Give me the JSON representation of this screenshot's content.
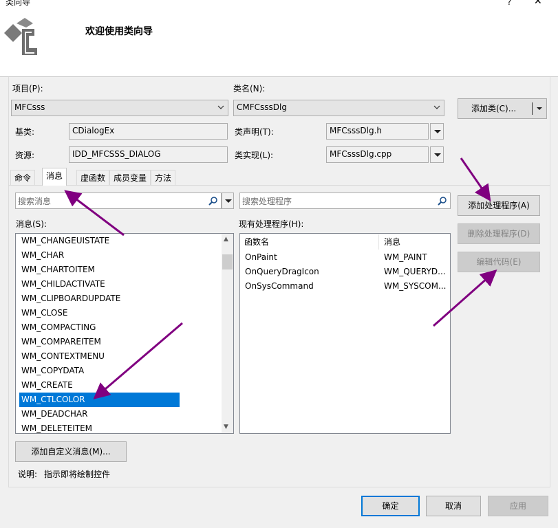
{
  "window": {
    "title": "类向导",
    "help": "?",
    "close": "✕"
  },
  "header": {
    "title": "欢迎使用类向导"
  },
  "project": {
    "label": "项目(P):",
    "value": "MFCsss"
  },
  "class_name": {
    "label": "类名(N):",
    "value": "CMFCsssDlg"
  },
  "add_class_button": "添加类(C)...",
  "base_class": {
    "label": "基类:",
    "value": "CDialogEx"
  },
  "resource": {
    "label": "资源:",
    "value": "IDD_MFCSSS_DIALOG"
  },
  "class_declaration": {
    "label": "类声明(T):",
    "value": "MFCsssDlg.h"
  },
  "class_implementation": {
    "label": "类实现(L):",
    "value": "MFCsssDlg.cpp"
  },
  "tabs": [
    {
      "label": "命令"
    },
    {
      "label": "消息"
    },
    {
      "label": "虚函数"
    },
    {
      "label": "成员变量"
    },
    {
      "label": "方法"
    }
  ],
  "search_messages": {
    "placeholder": "搜索消息"
  },
  "search_handlers": {
    "placeholder": "搜索处理程序"
  },
  "messages": {
    "label": "消息(S):",
    "items": [
      "WM_CHANGEUISTATE",
      "WM_CHAR",
      "WM_CHARTOITEM",
      "WM_CHILDACTIVATE",
      "WM_CLIPBOARDUPDATE",
      "WM_CLOSE",
      "WM_COMPACTING",
      "WM_COMPAREITEM",
      "WM_CONTEXTMENU",
      "WM_COPYDATA",
      "WM_CREATE",
      "WM_CTLCOLOR",
      "WM_DEADCHAR",
      "WM_DELETEITEM"
    ],
    "selected": "WM_CTLCOLOR"
  },
  "handlers": {
    "label": "现有处理程序(H):",
    "columns": [
      "函数名",
      "消息"
    ],
    "rows": [
      [
        "OnPaint",
        "WM_PAINT"
      ],
      [
        "OnQueryDragIcon",
        "WM_QUERYD..."
      ],
      [
        "OnSysCommand",
        "WM_SYSCOM..."
      ]
    ]
  },
  "buttons": {
    "add_handler": "添加处理程序(A)",
    "delete_handler": "删除处理程序(D)",
    "edit_code": "编辑代码(E)",
    "add_custom_message": "添加自定义消息(M)...",
    "ok": "确定",
    "cancel": "取消",
    "apply": "应用"
  },
  "description": {
    "label": "说明:",
    "text": "指示即将绘制控件"
  },
  "colors": {
    "selection": "#0078d7",
    "annotation_arrow": "#800080"
  }
}
